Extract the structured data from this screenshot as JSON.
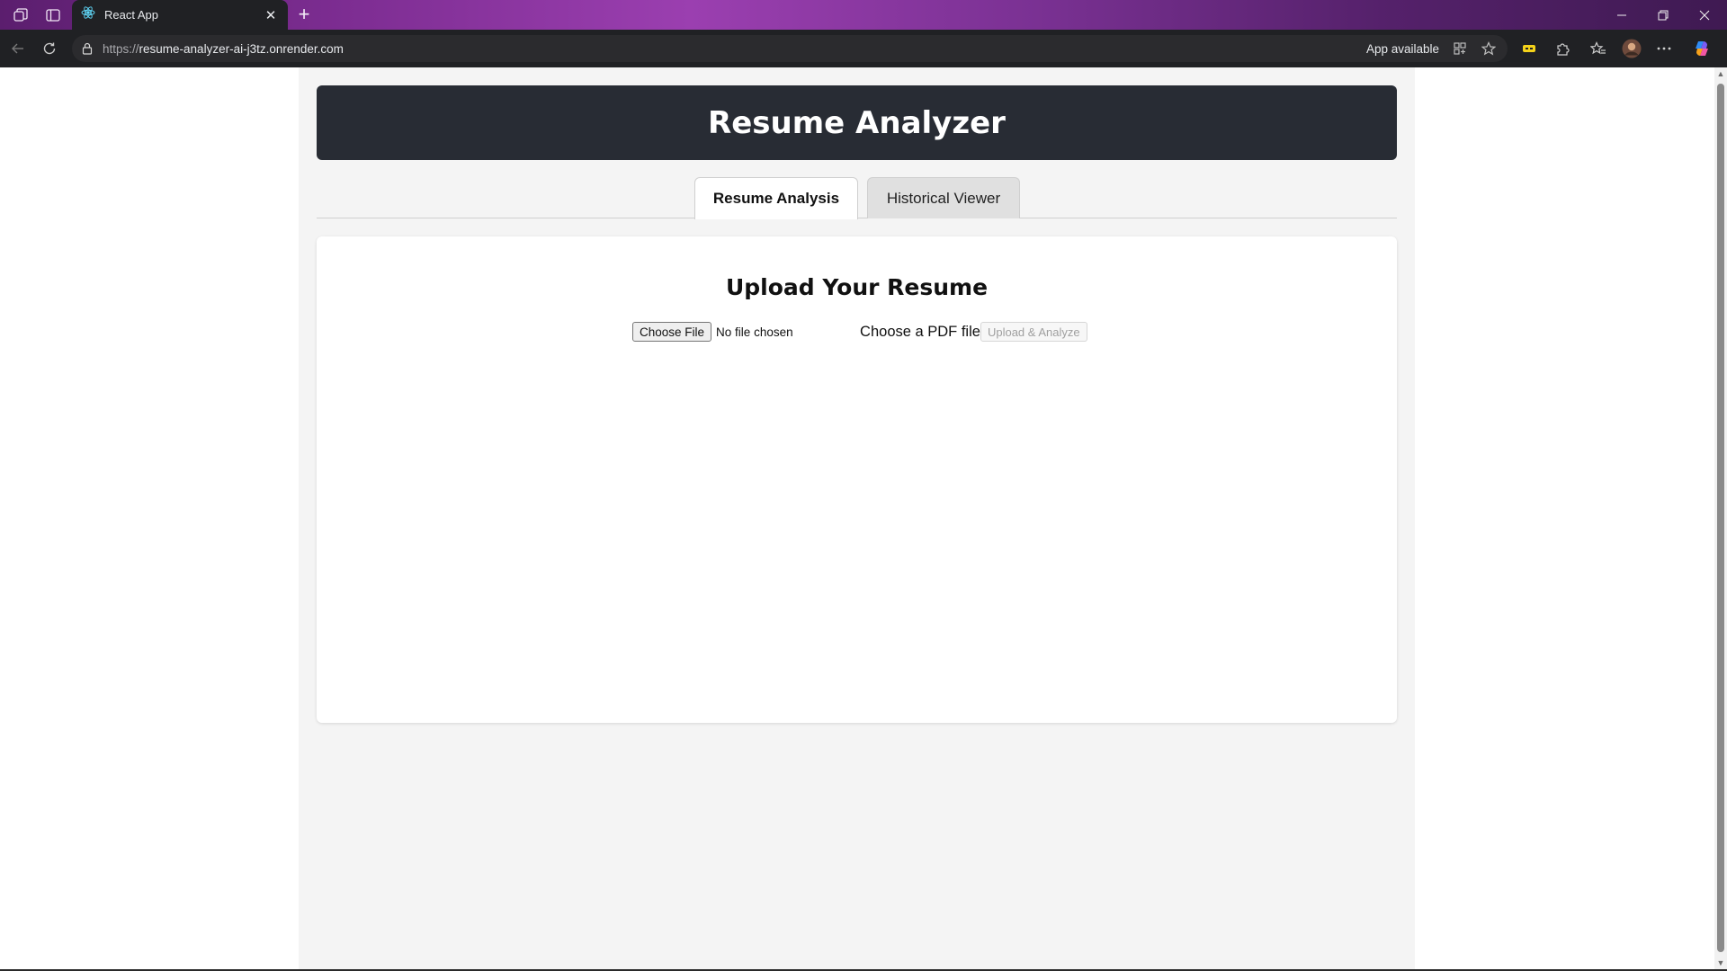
{
  "browser": {
    "tab": {
      "title": "React App"
    },
    "address": {
      "scheme": "https://",
      "host": "resume-analyzer-ai-j3tz.onrender.com"
    },
    "app_available_label": "App available",
    "icons": {
      "workspaces": "workspaces-icon",
      "tab_actions": "tab-actions-icon",
      "favicon": "react-icon",
      "close_tab": "close-icon",
      "new_tab": "plus-icon",
      "back": "back-arrow-icon",
      "refresh": "refresh-icon",
      "lock": "lock-icon",
      "install_app": "install-app-icon",
      "favorite": "star-icon",
      "extension": "extension-icon",
      "extensions": "puzzle-icon",
      "favorites": "favorites-icon",
      "profile": "avatar",
      "more": "more-icon",
      "copilot": "copilot-icon"
    }
  },
  "app": {
    "title": "Resume Analyzer",
    "tabs": [
      {
        "label": "Resume Analysis",
        "active": true
      },
      {
        "label": "Historical Viewer",
        "active": false
      }
    ],
    "upload": {
      "heading": "Upload Your Resume",
      "choose_button": "Choose File",
      "file_status": "No file chosen",
      "pdf_label": "Choose a PDF file",
      "analyze_button": "Upload & Analyze"
    }
  },
  "colors": {
    "header_bg": "#282c34",
    "page_bg": "#f4f4f4",
    "card_bg": "#ffffff"
  }
}
